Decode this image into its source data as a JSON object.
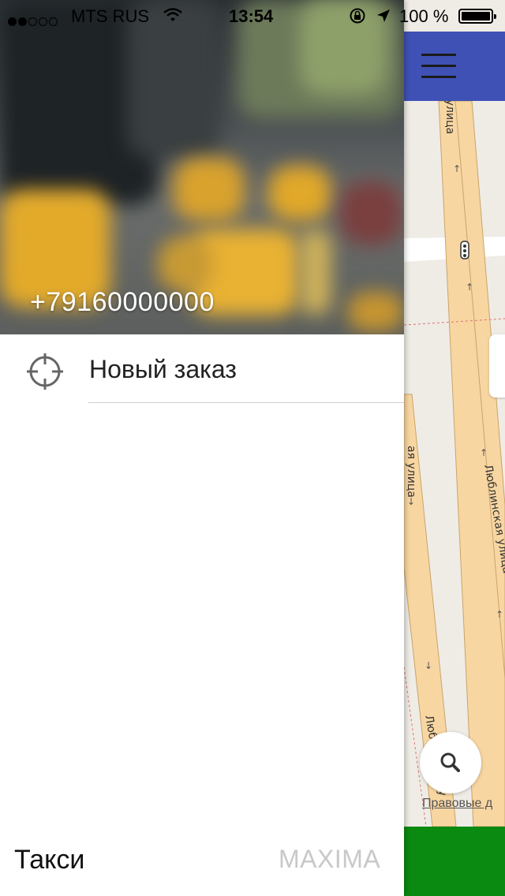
{
  "status_bar": {
    "carrier": "MTS RUS",
    "time": "13:54",
    "battery": "100 %",
    "signal_bars_filled": 2,
    "signal_bars_total": 5
  },
  "drawer": {
    "phone": "+79160000000",
    "menu": [
      {
        "label": "Новый заказ",
        "icon": "crosshair-icon"
      }
    ],
    "footer_left": "Такси",
    "footer_right": "MAXIMA"
  },
  "map": {
    "legal_link": "Правовые д",
    "street_labels": [
      "Люблинская улица",
      "Люблинская у",
      "улица",
      "ая улица"
    ],
    "colors": {
      "top_bar": "#3f51b5",
      "bottom_bar": "#0b8a12",
      "road": "#f8d6a2",
      "ground": "#efece6"
    }
  }
}
